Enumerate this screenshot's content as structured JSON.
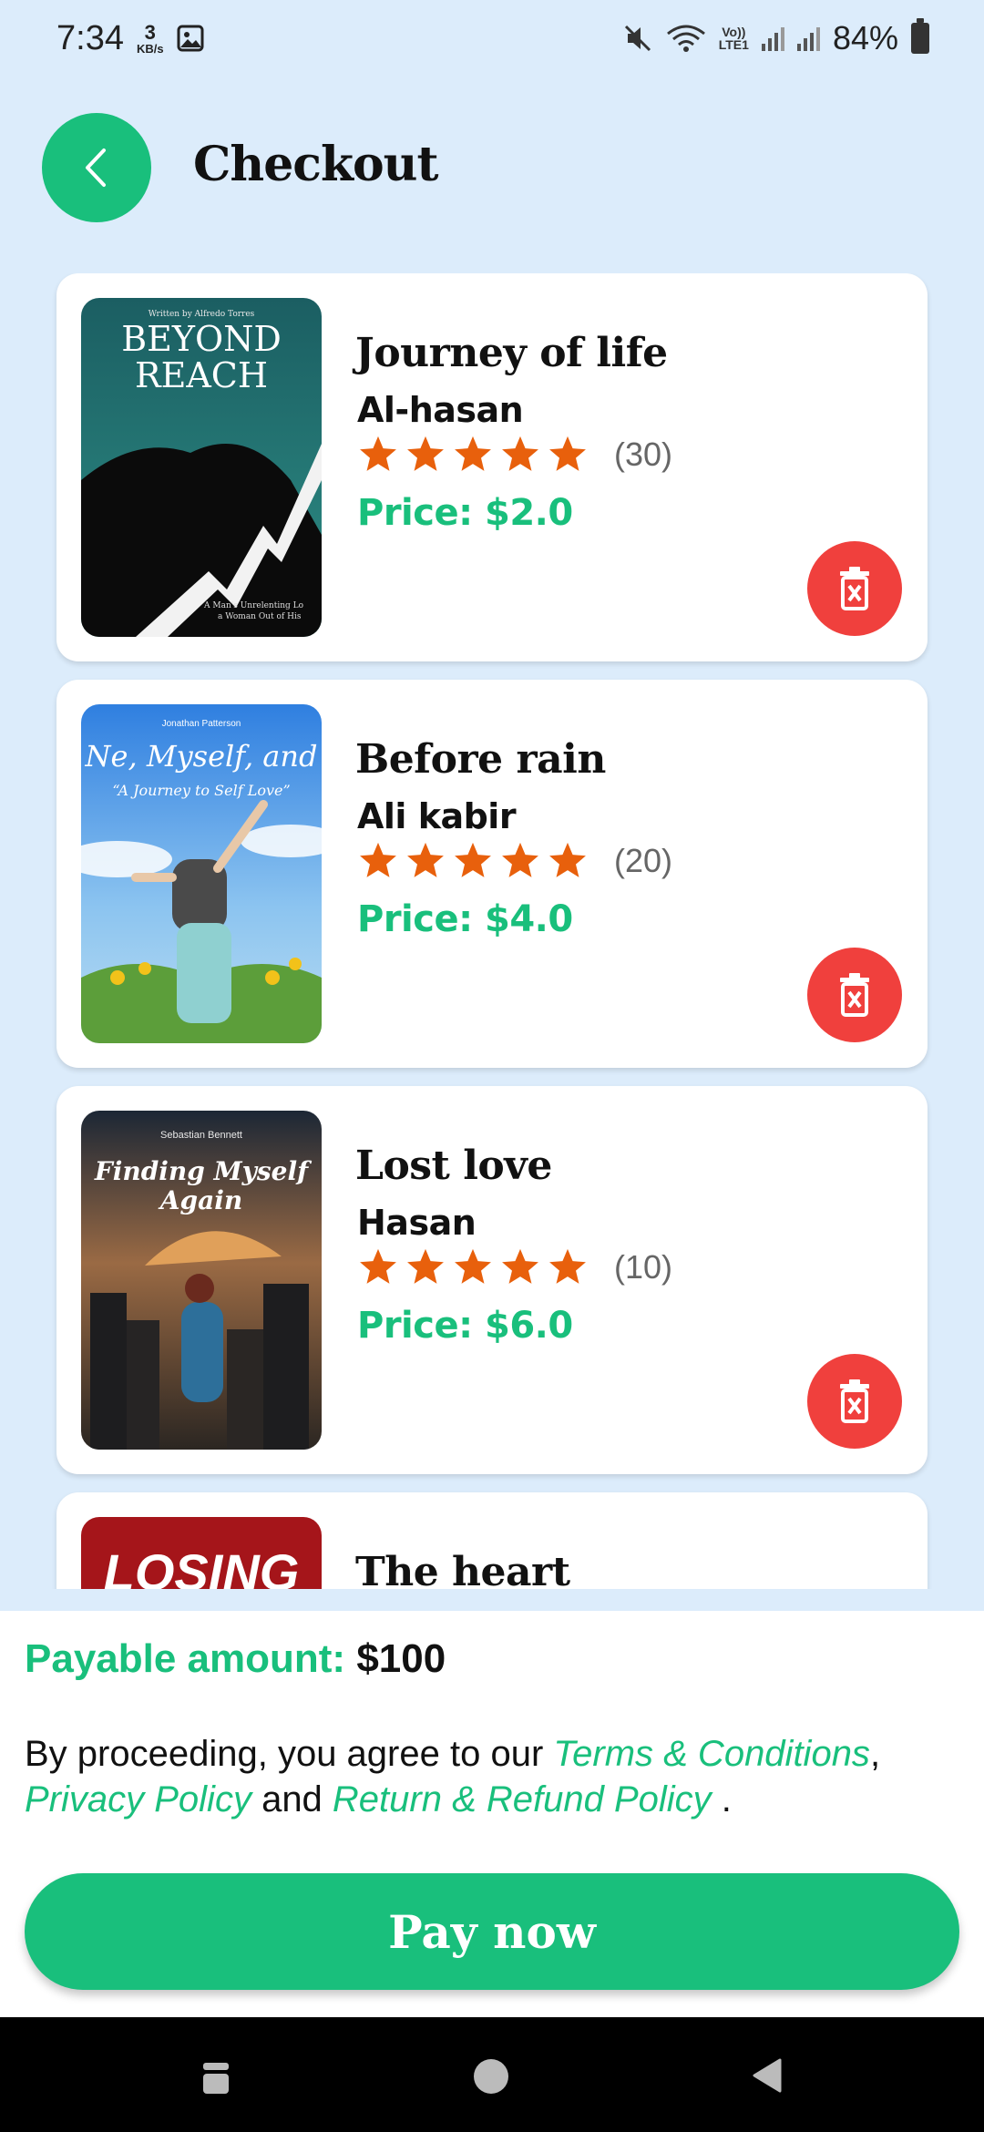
{
  "status_bar": {
    "time": "7:34",
    "net_speed_value": "3",
    "net_speed_unit": "KB/s",
    "lte_top": "Vo))",
    "lte_bottom": "LTE1",
    "battery": "84%"
  },
  "header": {
    "back_icon": "chevron-left-icon",
    "title": "Checkout"
  },
  "books": [
    {
      "title": "Journey of life",
      "author": "Al-hasan",
      "rating_count": "(30)",
      "price": "Price: $2.0",
      "cover": {
        "top_text": "Written by Alfredo Torres",
        "line1": "BEYOND",
        "line2": "REACH",
        "bottom_text1": "A Man's Unrelenting Lo",
        "bottom_text2": "a Woman Out of His "
      }
    },
    {
      "title": "Before rain",
      "author": "Ali kabir",
      "rating_count": "(20)",
      "price": "Price: $4.0",
      "cover": {
        "top_text": "Jonathan Patterson",
        "line1": "Ne, Myself, and",
        "line2": "“A Journey to Self Love”"
      }
    },
    {
      "title": "Lost love",
      "author": "Hasan",
      "rating_count": "(10)",
      "price": "Price: $6.0",
      "cover": {
        "top_text": "Sebastian Bennett",
        "line1": "Finding Myself",
        "line2": "Again"
      }
    },
    {
      "title": "The heart",
      "cover": {
        "line1": "LOSING"
      }
    }
  ],
  "rating_stars": 5,
  "summary": {
    "payable_label": "Payable amount:",
    "payable_amount": "$100",
    "terms_prefix": "By proceeding, you agree to our ",
    "terms_link": "Terms & Conditions",
    "comma": ",",
    "privacy_link": "Privacy Policy",
    "and_text": " and ",
    "refund_link": "Return & Refund Policy",
    "period": " ."
  },
  "pay_button": "Pay now",
  "colors": {
    "accent": "#19bf7c",
    "delete": "#f0403d",
    "star": "#e8600c",
    "background": "#dcecfb"
  }
}
